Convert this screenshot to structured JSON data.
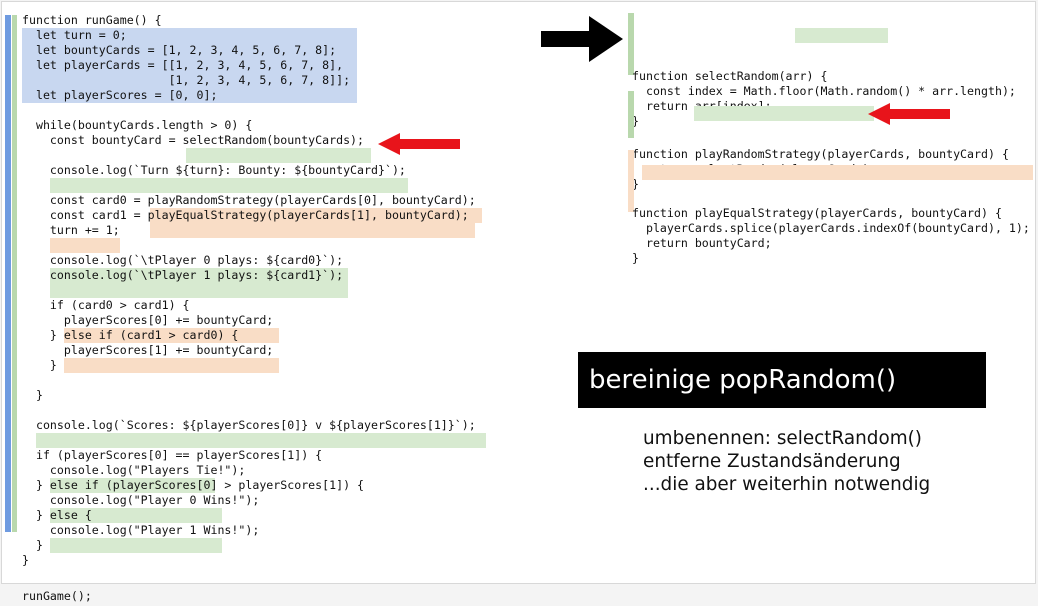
{
  "colors": {
    "green": "#d7ead0",
    "blue": "#c8d7f0",
    "orange": "#f9ddc6",
    "bar_blue": "#6f9be0",
    "bar_green": "#b9d8ad",
    "arrow_red": "#e8141b",
    "arrow_black": "#000000"
  },
  "main_code": {
    "lines": [
      "function runGame() {",
      "  let turn = 0;",
      "  let bountyCards = [1, 2, 3, 4, 5, 6, 7, 8];",
      "  let playerCards = [[1, 2, 3, 4, 5, 6, 7, 8],",
      "                     [1, 2, 3, 4, 5, 6, 7, 8]];",
      "  let playerScores = [0, 0];",
      "",
      "  while(bountyCards.length > 0) {",
      "    const bountyCard = selectRandom(bountyCards);",
      "",
      "    console.log(`Turn ${turn}: Bounty: ${bountyCard}`);",
      "",
      "    const card0 = playRandomStrategy(playerCards[0], bountyCard);",
      "    const card1 = playEqualStrategy(playerCards[1], bountyCard);",
      "    turn += 1;",
      "",
      "    console.log(`\\tPlayer 0 plays: ${card0}`);",
      "    console.log(`\\tPlayer 1 plays: ${card1}`);",
      "",
      "    if (card0 > card1) {",
      "      playerScores[0] += bountyCard;",
      "    } else if (card1 > card0) {",
      "      playerScores[1] += bountyCard;",
      "    }",
      "",
      "  }",
      "",
      "  console.log(`Scores: ${playerScores[0]} v ${playerScores[1]}`);",
      "",
      "  if (playerScores[0] == playerScores[1]) {",
      "    console.log(\"Players Tie!\");",
      "  } else if (playerScores[0] > playerScores[1]) {",
      "    console.log(\"Player 0 Wins!\");",
      "  } else {",
      "    console.log(\"Player 1 Wins!\");",
      "  }",
      "}"
    ]
  },
  "select_random_fn": {
    "lines": [
      "function selectRandom(arr) {",
      "  const index = Math.floor(Math.random() * arr.length);",
      "  return arr[index];",
      "}"
    ]
  },
  "play_random_fn": {
    "lines": [
      "function playRandomStrategy(playerCards, bountyCard) {",
      "  return selectRandom(playerCards);",
      "}"
    ]
  },
  "play_equal_fn": {
    "lines": [
      "function playEqualStrategy(playerCards, bountyCard) {",
      "  playerCards.splice(playerCards.indexOf(bountyCard), 1);",
      "  return bountyCard;",
      "}"
    ]
  },
  "footer_call": "runGame();",
  "slide_title": "bereinige popRandom()",
  "notes": [
    "umbenennen: selectRandom()",
    "entferne Zustandsänderung",
    "...die aber weiterhin notwendig"
  ]
}
